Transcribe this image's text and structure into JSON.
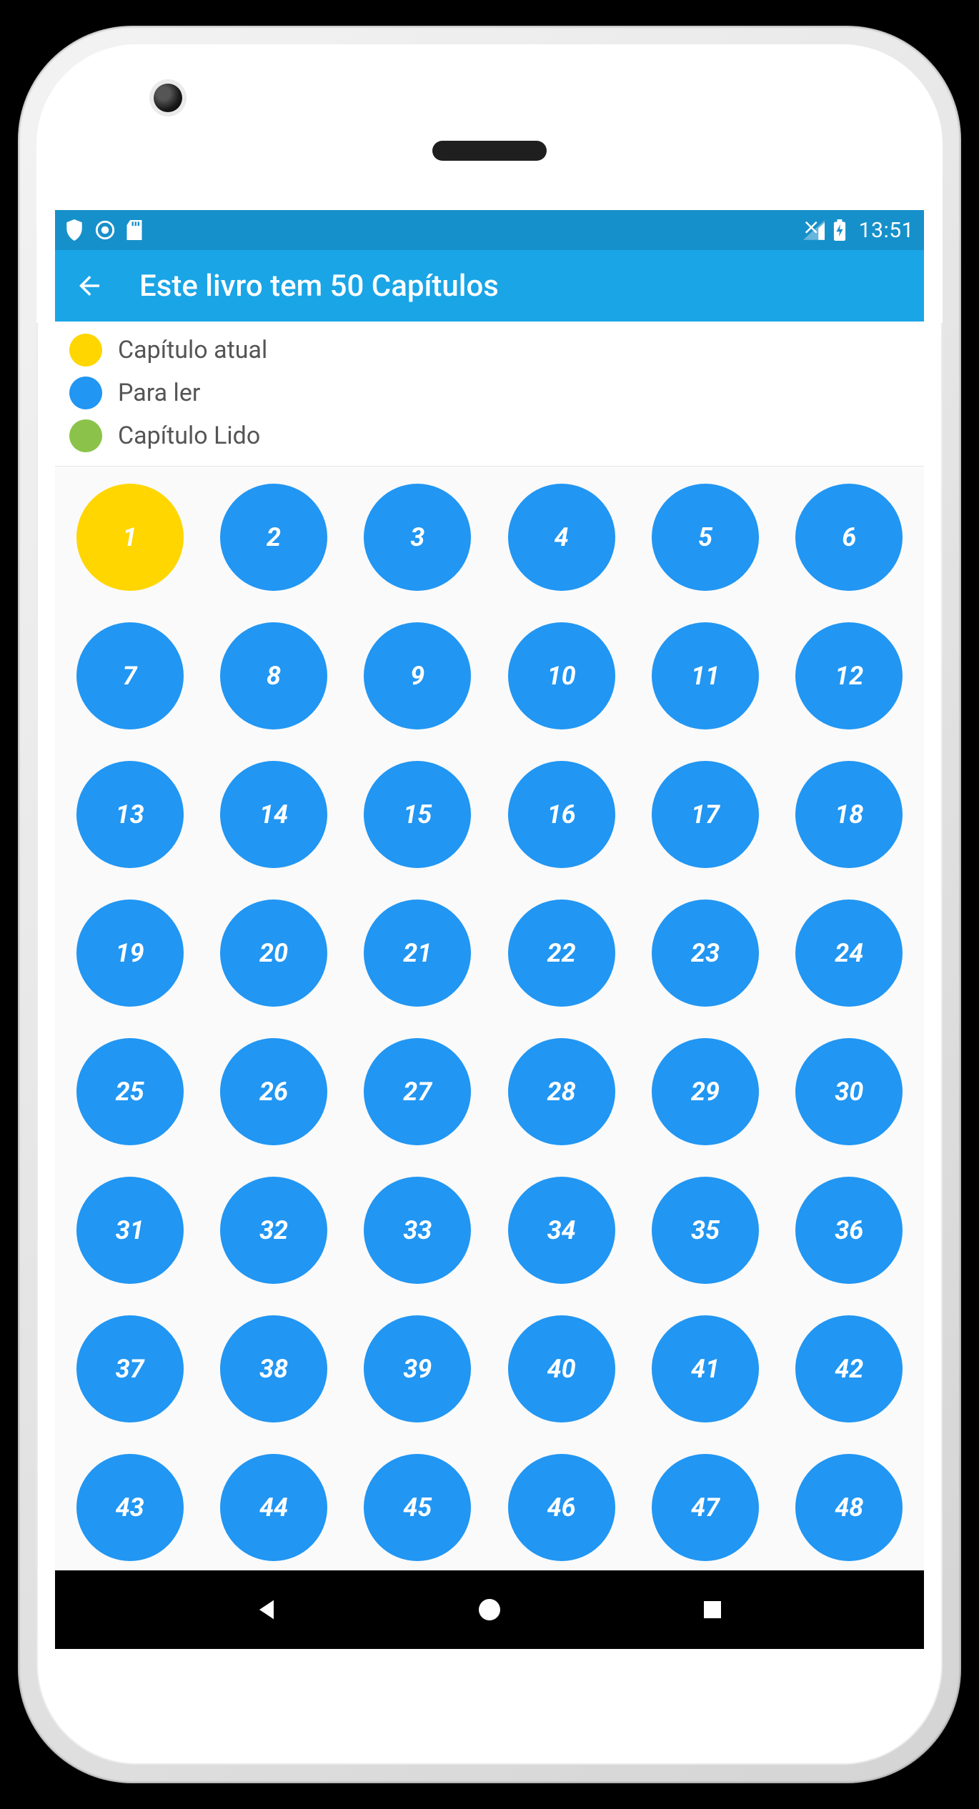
{
  "statusbar": {
    "time": "13:51"
  },
  "appbar": {
    "title": "Este livro tem 50 Capítulos"
  },
  "legend": {
    "items": [
      {
        "label": "Capítulo atual",
        "color": "#ffd600"
      },
      {
        "label": "Para ler",
        "color": "#2196f3"
      },
      {
        "label": "Capítulo Lido",
        "color": "#8bc34a"
      }
    ]
  },
  "colors": {
    "current": "#ffd600",
    "to_read": "#2196f3",
    "read": "#8bc34a"
  },
  "chapters": {
    "total": 50,
    "current": 1,
    "read": []
  }
}
